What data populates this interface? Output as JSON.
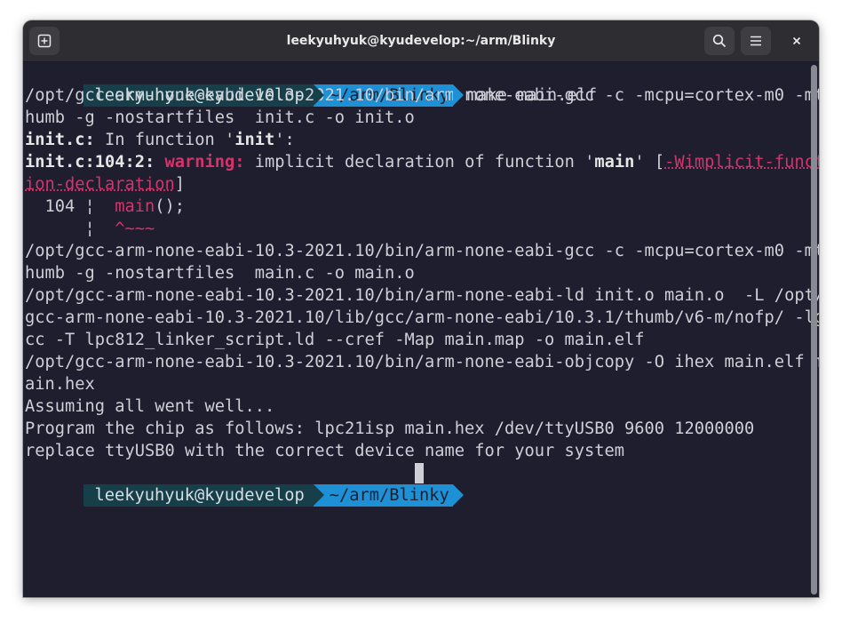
{
  "window": {
    "title": "leekyuhyuk@kyudevelop:~/arm/Blinky"
  },
  "titlebar": {
    "new_tab_icon": "new-tab-icon",
    "search_icon": "search-icon",
    "menu_icon": "hamburger-menu-icon",
    "close_icon": "close-icon"
  },
  "prompt": {
    "user": "leekyuhyuk@kyudevelop",
    "path": "~/arm/Blinky"
  },
  "first_command": "make main.elf",
  "output": {
    "l1": "/opt/gcc-arm-none-eabi-10.3-2021.10/bin/arm-none-eabi-gcc -c -mcpu=cortex-m0 -mt",
    "l2": "humb -g -nostartfiles  init.c -o init.o",
    "l3_a": "init.c:",
    "l3_b": " In function '",
    "l3_c": "init",
    "l3_d": "':",
    "l4_a": "init.c:104:2:",
    "l4_b": " ",
    "l4_c": "warning:",
    "l4_d": " implicit declaration of function '",
    "l4_e": "main",
    "l4_f": "' [",
    "l4_g": "-Wimplicit-funct",
    "l5_a": "ion-declaration",
    "l5_b": "]",
    "l6_a": "  104 ¦  ",
    "l6_b": "main",
    "l6_c": "();",
    "l7_a": "      ¦  ",
    "l7_b": "^~~~",
    "l8": "/opt/gcc-arm-none-eabi-10.3-2021.10/bin/arm-none-eabi-gcc -c -mcpu=cortex-m0 -mt",
    "l9": "humb -g -nostartfiles  main.c -o main.o",
    "l10": "/opt/gcc-arm-none-eabi-10.3-2021.10/bin/arm-none-eabi-ld init.o main.o  -L /opt/",
    "l11": "gcc-arm-none-eabi-10.3-2021.10/lib/gcc/arm-none-eabi/10.3.1/thumb/v6-m/nofp/ -lg",
    "l12": "cc -T lpc812_linker_script.ld --cref -Map main.map -o main.elf",
    "l13": "/opt/gcc-arm-none-eabi-10.3-2021.10/bin/arm-none-eabi-objcopy -O ihex main.elf m",
    "l14": "ain.hex",
    "l15": "Assuming all went well...",
    "l16": "Program the chip as follows: lpc21isp main.hex /dev/ttyUSB0 9600 12000000",
    "l17": "replace ttyUSB0 with the correct device name for your system"
  }
}
